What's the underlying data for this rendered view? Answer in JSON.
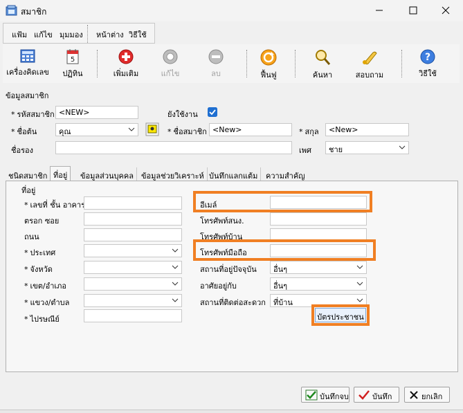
{
  "window": {
    "title": "สมาชิก"
  },
  "menu": {
    "items": [
      "แฟ้ม",
      "แก้ไข",
      "มุมมอง",
      "หน้าต่าง",
      "วิธีใช้"
    ]
  },
  "toolbar": {
    "calculator_label": "เครื่องคิดเลข",
    "calendar_label": "ปฏิทิน",
    "add_label": "เพิ่มเติม",
    "edit_label": "แก้ไข",
    "delete_label": "ลบ",
    "restore_label": "ฟื้นฟู",
    "search_label": "ค้นหา",
    "inquiry_label": "สอบถาม",
    "help_label": "วิธีใช้"
  },
  "member": {
    "group_label": "ข้อมูลสมาชิก",
    "id_label": "รหัสสมาชิก",
    "id_value": "<NEW>",
    "active_label": "ยังใช้งาน",
    "active_checked": true,
    "title_label": "ชื่อต้น",
    "title_value": "คุณ",
    "name_label": "ชื่อสมาชิก",
    "name_value": "<New>",
    "surname_label": "สกุล",
    "surname_value": "<New>",
    "middle_label": "ชื่อรอง",
    "middle_value": "",
    "gender_label": "เพศ",
    "gender_value": "ชาย"
  },
  "tabs": [
    {
      "label": "ชนิดสมาชิก"
    },
    {
      "label": "ที่อยู่"
    },
    {
      "label": "ข้อมูลส่วนบุคคล"
    },
    {
      "label": "ข้อมูลช่วยวิเคราะห์"
    },
    {
      "label": "บันทึกแลกแต้ม"
    },
    {
      "label": "ความสำคัญ"
    }
  ],
  "address": {
    "group_label": "ที่อยู่",
    "house_label": "เลขที่ ชั้น อาคาร",
    "alley_label": "ตรอก ซอย",
    "road_label": "ถนน",
    "country_label": "ประเทศ",
    "province_label": "จังหวัด",
    "district_label": "เขต/อำเภอ",
    "subdistrict_label": "แขวง/ตำบล",
    "postcode_label": "ไปรษณีย์",
    "email_label": "อีเมล์",
    "office_phone_label": "โทรศัพท์สนง.",
    "home_phone_label": "โทรศัพท์บ้าน",
    "mobile_label": "โทรศัพท์มือถือ",
    "current_place_label": "สถานที่อยู่ปัจจุบัน",
    "current_place_value": "อื่นๆ",
    "living_with_label": "อาศัยอยู่กับ",
    "living_with_value": "อื่นๆ",
    "contact_place_label": "สถานที่ติดต่อสะดวก",
    "contact_place_value": "ที่บ้าน",
    "id_card_button": "บัตรประชาชน"
  },
  "footer": {
    "save_close_label": "บันทึกจบ",
    "save_label": "บันทึก",
    "cancel_label": "ยกเลิก"
  },
  "colors": {
    "highlight": "#f07f23",
    "checkbox": "#1f6fd1"
  }
}
